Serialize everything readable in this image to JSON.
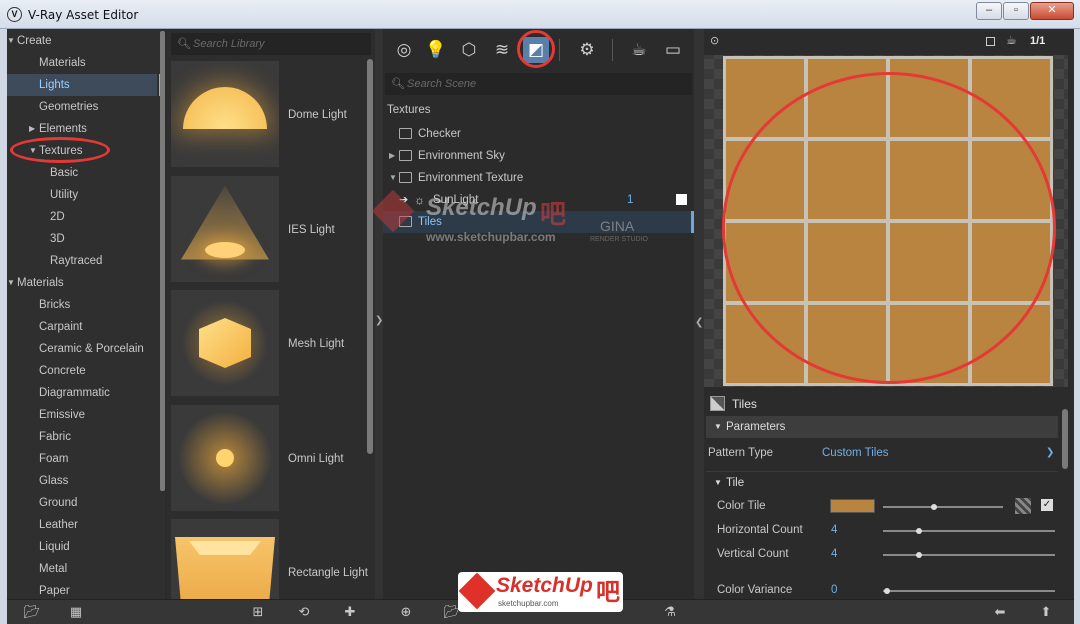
{
  "window": {
    "title": "V-Ray Asset Editor",
    "min_label": "–",
    "max_label": "▫",
    "close_label": "✕"
  },
  "tree": {
    "items": [
      {
        "label": "Create",
        "level": 0,
        "caret": "▼"
      },
      {
        "label": "Materials",
        "level": 1
      },
      {
        "label": "Lights",
        "level": 1,
        "active": true
      },
      {
        "label": "Geometries",
        "level": 1
      },
      {
        "label": "Elements",
        "level": 1,
        "caret": "▶"
      },
      {
        "label": "Textures",
        "level": 1,
        "caret": "▼"
      },
      {
        "label": "Basic",
        "level": 2
      },
      {
        "label": "Utility",
        "level": 2
      },
      {
        "label": "2D",
        "level": 2
      },
      {
        "label": "3D",
        "level": 2
      },
      {
        "label": "Raytraced",
        "level": 2
      },
      {
        "label": "Materials",
        "level": 0,
        "caret": "▼"
      },
      {
        "label": "Bricks",
        "level": 1
      },
      {
        "label": "Carpaint",
        "level": 1
      },
      {
        "label": "Ceramic & Porcelain",
        "level": 1
      },
      {
        "label": "Concrete",
        "level": 1
      },
      {
        "label": "Diagrammatic",
        "level": 1
      },
      {
        "label": "Emissive",
        "level": 1
      },
      {
        "label": "Fabric",
        "level": 1
      },
      {
        "label": "Foam",
        "level": 1
      },
      {
        "label": "Glass",
        "level": 1
      },
      {
        "label": "Ground",
        "level": 1
      },
      {
        "label": "Leather",
        "level": 1
      },
      {
        "label": "Liquid",
        "level": 1
      },
      {
        "label": "Metal",
        "level": 1
      },
      {
        "label": "Paper",
        "level": 1
      }
    ]
  },
  "library": {
    "search_placeholder": "Search Library",
    "items": [
      {
        "label": "Dome Light",
        "icon": "dome-light-icon"
      },
      {
        "label": "IES Light",
        "icon": "ies-light-icon"
      },
      {
        "label": "Mesh Light",
        "icon": "mesh-light-icon"
      },
      {
        "label": "Omni Light",
        "icon": "omni-light-icon"
      },
      {
        "label": "Rectangle Light",
        "icon": "rectangle-light-icon"
      }
    ]
  },
  "toolbar": {
    "buttons": [
      {
        "name": "materials-icon",
        "glyph": "◎"
      },
      {
        "name": "lights-icon",
        "glyph": "💡"
      },
      {
        "name": "geometry-icon",
        "glyph": "⬡"
      },
      {
        "name": "render-elements-icon",
        "glyph": "≋"
      },
      {
        "name": "textures-icon",
        "glyph": "◩",
        "selected": true
      },
      {
        "name": "settings-icon",
        "glyph": "⚙"
      },
      {
        "name": "render-teapot-icon",
        "glyph": "☕"
      },
      {
        "name": "frame-buffer-icon",
        "glyph": "▭"
      }
    ]
  },
  "scene": {
    "search_placeholder": "Search Scene",
    "heading": "Textures",
    "rows": [
      {
        "label": "Checker",
        "caret": ""
      },
      {
        "label": "Environment Sky",
        "caret": "▶"
      },
      {
        "label": "Environment Texture",
        "caret": "▼"
      },
      {
        "label": "SunLight",
        "count": "1",
        "child": true
      },
      {
        "label": "Tiles",
        "selected": true
      }
    ]
  },
  "preview": {
    "zoom_label": "1/1",
    "tile_color": "#b9843f",
    "grout_color": "#c8c1b6"
  },
  "properties": {
    "header": "Tiles",
    "section_parameters": "Parameters",
    "pattern_type_label": "Pattern Type",
    "pattern_type_value": "Custom Tiles",
    "section_tile": "Tile",
    "color_tile_label": "Color Tile",
    "color_tile_value": "#b9843f",
    "horizontal_count_label": "Horizontal Count",
    "horizontal_count_value": "4",
    "vertical_count_label": "Vertical Count",
    "vertical_count_value": "4",
    "color_variance_label": "Color Variance",
    "color_variance_value": "0"
  },
  "watermark": {
    "brand": "SketchUp",
    "brand_suffix": "吧",
    "site": "www.sketchupbar.com",
    "site_small": "sketchupbar.com",
    "gina": "GINA",
    "gina_sub": "RENDER STUDIO"
  }
}
